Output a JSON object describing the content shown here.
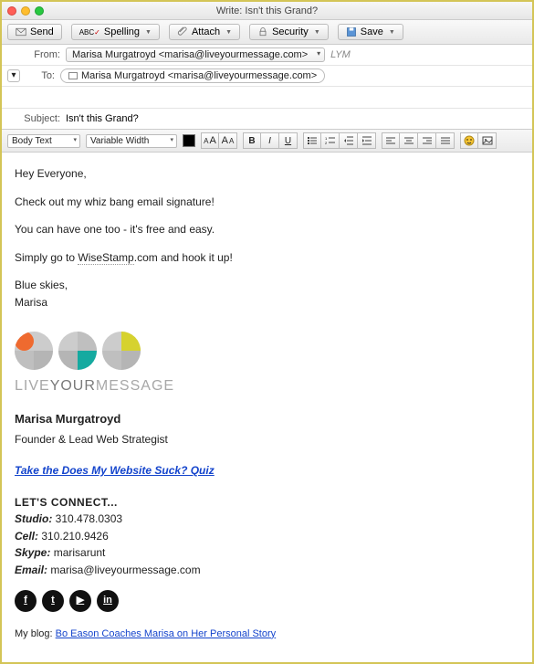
{
  "window": {
    "title": "Write: Isn't this Grand?"
  },
  "toolbar": {
    "send": "Send",
    "spelling": "Spelling",
    "attach": "Attach",
    "security": "Security",
    "save": "Save"
  },
  "headers": {
    "from_label": "From:",
    "from_value": "Marisa Murgatroyd <marisa@liveyourmessage.com>",
    "from_sig": "LYM",
    "to_label": "To:",
    "to_value": "Marisa Murgatroyd <marisa@liveyourmessage.com>",
    "subject_label": "Subject:",
    "subject_value": "Isn't this Grand?"
  },
  "format": {
    "style": "Body Text",
    "font": "Variable Width"
  },
  "body": {
    "greeting": "Hey Everyone,",
    "l1": "Check out my whiz bang email signature!",
    "l2": "You can have one too - it's free and easy.",
    "l3a": "Simply go to ",
    "l3_link": "WiseStamp",
    "l3b": ".com and hook it up!",
    "closing1": "Blue skies,",
    "closing2": "Marisa"
  },
  "signature": {
    "brand_a": "LIVE",
    "brand_b": "YOUR",
    "brand_c": "MESSAGE",
    "name": "Marisa Murgatroyd",
    "title": "Founder & Lead Web Strategist",
    "quiz": "Take the Does My Website Suck? Quiz",
    "connect_hdr": "LET'S CONNECT...",
    "studio_lbl": "Studio:",
    "studio_val": " 310.478.0303",
    "cell_lbl": "Cell:",
    "cell_val": " 310.210.9426",
    "skype_lbl": "Skype:",
    "skype_val": " marisarunt",
    "email_lbl": "Email:",
    "email_val": " marisa@liveyourmessage.com",
    "blog_lead": "My blog: ",
    "blog_link": "Bo Eason Coaches Marisa on Her Personal Story"
  }
}
